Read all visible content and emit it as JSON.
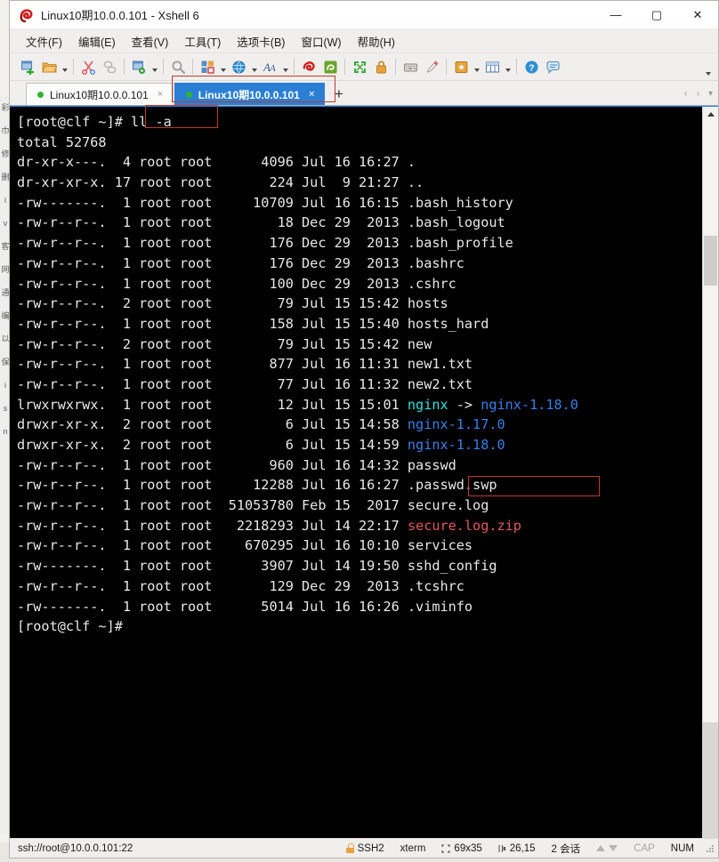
{
  "window": {
    "title": "Linux10期10.0.0.101 - Xshell 6",
    "icon": "xshell-logo-icon",
    "controls": {
      "minimize": "—",
      "maximize": "▢",
      "close": "✕"
    }
  },
  "menubar": {
    "items": [
      {
        "label": "文件(F)",
        "name": "menu-file"
      },
      {
        "label": "编辑(E)",
        "name": "menu-edit"
      },
      {
        "label": "查看(V)",
        "name": "menu-view"
      },
      {
        "label": "工具(T)",
        "name": "menu-tools"
      },
      {
        "label": "选项卡(B)",
        "name": "menu-tabs"
      },
      {
        "label": "窗口(W)",
        "name": "menu-window"
      },
      {
        "label": "帮助(H)",
        "name": "menu-help"
      }
    ]
  },
  "toolbar": {
    "icons": [
      "new-session-icon",
      "open-folder-icon",
      "cut-icon",
      "copy-link-icon",
      "properties-icon",
      "search-icon",
      "layout-icon",
      "globe-icon",
      "font-icon",
      "xshell-icon",
      "xftp-icon",
      "fullscreen-icon",
      "lock-icon",
      "keyboard-icon",
      "highlight-pen-icon",
      "compose-icon",
      "table-icon",
      "help-icon",
      "chat-icon"
    ],
    "overflow": "toolbar-overflow-caret"
  },
  "tabs": {
    "items": [
      {
        "label": "Linux10期10.0.0.101",
        "active": false,
        "status": "connected",
        "close": "×"
      },
      {
        "label": "Linux10期10.0.0.101",
        "active": true,
        "status": "connected",
        "close": "×"
      }
    ],
    "add_label": "+",
    "nav_prev": "‹",
    "nav_next": "›",
    "nav_menu": "▾"
  },
  "terminal": {
    "prompt": "[root@clf ~]# ",
    "command": "ll -a",
    "total_line": "total 52768",
    "columns_note": "perms links owner group size month day time name",
    "rows": [
      {
        "perms": "dr-xr-x---.",
        "links": "4",
        "owner": "root",
        "group": "root",
        "size": "4096",
        "month": "Jul",
        "day": "16",
        "time": "16:27",
        "name": ".",
        "color": "white"
      },
      {
        "perms": "dr-xr-xr-x.",
        "links": "17",
        "owner": "root",
        "group": "root",
        "size": "224",
        "month": "Jul",
        "day": "9",
        "time": "21:27",
        "name": "..",
        "color": "white"
      },
      {
        "perms": "-rw-------.",
        "links": "1",
        "owner": "root",
        "group": "root",
        "size": "10709",
        "month": "Jul",
        "day": "16",
        "time": "16:15",
        "name": ".bash_history",
        "color": "white"
      },
      {
        "perms": "-rw-r--r--.",
        "links": "1",
        "owner": "root",
        "group": "root",
        "size": "18",
        "month": "Dec",
        "day": "29",
        "time": "2013",
        "name": ".bash_logout",
        "color": "white"
      },
      {
        "perms": "-rw-r--r--.",
        "links": "1",
        "owner": "root",
        "group": "root",
        "size": "176",
        "month": "Dec",
        "day": "29",
        "time": "2013",
        "name": ".bash_profile",
        "color": "white"
      },
      {
        "perms": "-rw-r--r--.",
        "links": "1",
        "owner": "root",
        "group": "root",
        "size": "176",
        "month": "Dec",
        "day": "29",
        "time": "2013",
        "name": ".bashrc",
        "color": "white"
      },
      {
        "perms": "-rw-r--r--.",
        "links": "1",
        "owner": "root",
        "group": "root",
        "size": "100",
        "month": "Dec",
        "day": "29",
        "time": "2013",
        "name": ".cshrc",
        "color": "white"
      },
      {
        "perms": "-rw-r--r--.",
        "links": "2",
        "owner": "root",
        "group": "root",
        "size": "79",
        "month": "Jul",
        "day": "15",
        "time": "15:42",
        "name": "hosts",
        "color": "white"
      },
      {
        "perms": "-rw-r--r--.",
        "links": "1",
        "owner": "root",
        "group": "root",
        "size": "158",
        "month": "Jul",
        "day": "15",
        "time": "15:40",
        "name": "hosts_hard",
        "color": "white"
      },
      {
        "perms": "-rw-r--r--.",
        "links": "2",
        "owner": "root",
        "group": "root",
        "size": "79",
        "month": "Jul",
        "day": "15",
        "time": "15:42",
        "name": "new",
        "color": "white"
      },
      {
        "perms": "-rw-r--r--.",
        "links": "1",
        "owner": "root",
        "group": "root",
        "size": "877",
        "month": "Jul",
        "day": "16",
        "time": "11:31",
        "name": "new1.txt",
        "color": "white"
      },
      {
        "perms": "-rw-r--r--.",
        "links": "1",
        "owner": "root",
        "group": "root",
        "size": "77",
        "month": "Jul",
        "day": "16",
        "time": "11:32",
        "name": "new2.txt",
        "color": "white"
      },
      {
        "perms": "lrwxrwxrwx.",
        "links": "1",
        "owner": "root",
        "group": "root",
        "size": "12",
        "month": "Jul",
        "day": "15",
        "time": "15:01",
        "name": "nginx -> nginx-1.18.0",
        "color": "symlink"
      },
      {
        "perms": "drwxr-xr-x.",
        "links": "2",
        "owner": "root",
        "group": "root",
        "size": "6",
        "month": "Jul",
        "day": "15",
        "time": "14:58",
        "name": "nginx-1.17.0",
        "color": "dir"
      },
      {
        "perms": "drwxr-xr-x.",
        "links": "2",
        "owner": "root",
        "group": "root",
        "size": "6",
        "month": "Jul",
        "day": "15",
        "time": "14:59",
        "name": "nginx-1.18.0",
        "color": "dir"
      },
      {
        "perms": "-rw-r--r--.",
        "links": "1",
        "owner": "root",
        "group": "root",
        "size": "960",
        "month": "Jul",
        "day": "16",
        "time": "14:32",
        "name": "passwd",
        "color": "white"
      },
      {
        "perms": "-rw-r--r--.",
        "links": "1",
        "owner": "root",
        "group": "root",
        "size": "12288",
        "month": "Jul",
        "day": "16",
        "time": "16:27",
        "name": ".passwd.swp",
        "color": "white"
      },
      {
        "perms": "-rw-r--r--.",
        "links": "1",
        "owner": "root",
        "group": "root",
        "size": "51053780",
        "month": "Feb",
        "day": "15",
        "time": "2017",
        "name": "secure.log",
        "color": "white"
      },
      {
        "perms": "-rw-r--r--.",
        "links": "1",
        "owner": "root",
        "group": "root",
        "size": "2218293",
        "month": "Jul",
        "day": "14",
        "time": "22:17",
        "name": "secure.log.zip",
        "color": "archive"
      },
      {
        "perms": "-rw-r--r--.",
        "links": "1",
        "owner": "root",
        "group": "root",
        "size": "670295",
        "month": "Jul",
        "day": "16",
        "time": "10:10",
        "name": "services",
        "color": "white"
      },
      {
        "perms": "-rw-------.",
        "links": "1",
        "owner": "root",
        "group": "root",
        "size": "3907",
        "month": "Jul",
        "day": "14",
        "time": "19:50",
        "name": "sshd_config",
        "color": "white"
      },
      {
        "perms": "-rw-r--r--.",
        "links": "1",
        "owner": "root",
        "group": "root",
        "size": "129",
        "month": "Dec",
        "day": "29",
        "time": "2013",
        "name": ".tcshrc",
        "color": "white"
      },
      {
        "perms": "-rw-------.",
        "links": "1",
        "owner": "root",
        "group": "root",
        "size": "5014",
        "month": "Jul",
        "day": "16",
        "time": "16:26",
        "name": ".viminfo",
        "color": "white"
      }
    ],
    "final_prompt": "[root@clf ~]# ",
    "colors": {
      "background": "#000000",
      "foreground": "#e8e8e8",
      "symlink": "#2ee0e0",
      "directory": "#3a7fe8",
      "archive": "#e05a5a",
      "annotation": "#c0392b"
    }
  },
  "annotations": [
    {
      "name": "annotation-box-command",
      "target": "ll -a"
    },
    {
      "name": "annotation-box-active-tab",
      "target": "Linux10期10.0.0.101"
    },
    {
      "name": "annotation-box-passwd-swp",
      "target": ".passwd.swp"
    }
  ],
  "statusbar": {
    "url": "ssh://root@10.0.0.101:22",
    "protocol": "SSH2",
    "terminal_type": "xterm",
    "size_icon": "terminal-size-icon",
    "size": "69x35",
    "cursor_icon": "cursor-position-icon",
    "cursor": "26,15",
    "sessions": "2 会话",
    "transfer_up": "▲",
    "transfer_down": "▼",
    "cap": "CAP",
    "num": "NUM"
  },
  "background_window": {
    "sidebar_glyphs": [
      "彩",
      "巾",
      "修",
      "删",
      "i",
      "v",
      "客",
      "网",
      "通",
      "编",
      "以",
      "保",
      "i",
      "s",
      "n"
    ],
    "ghost_text": ""
  }
}
